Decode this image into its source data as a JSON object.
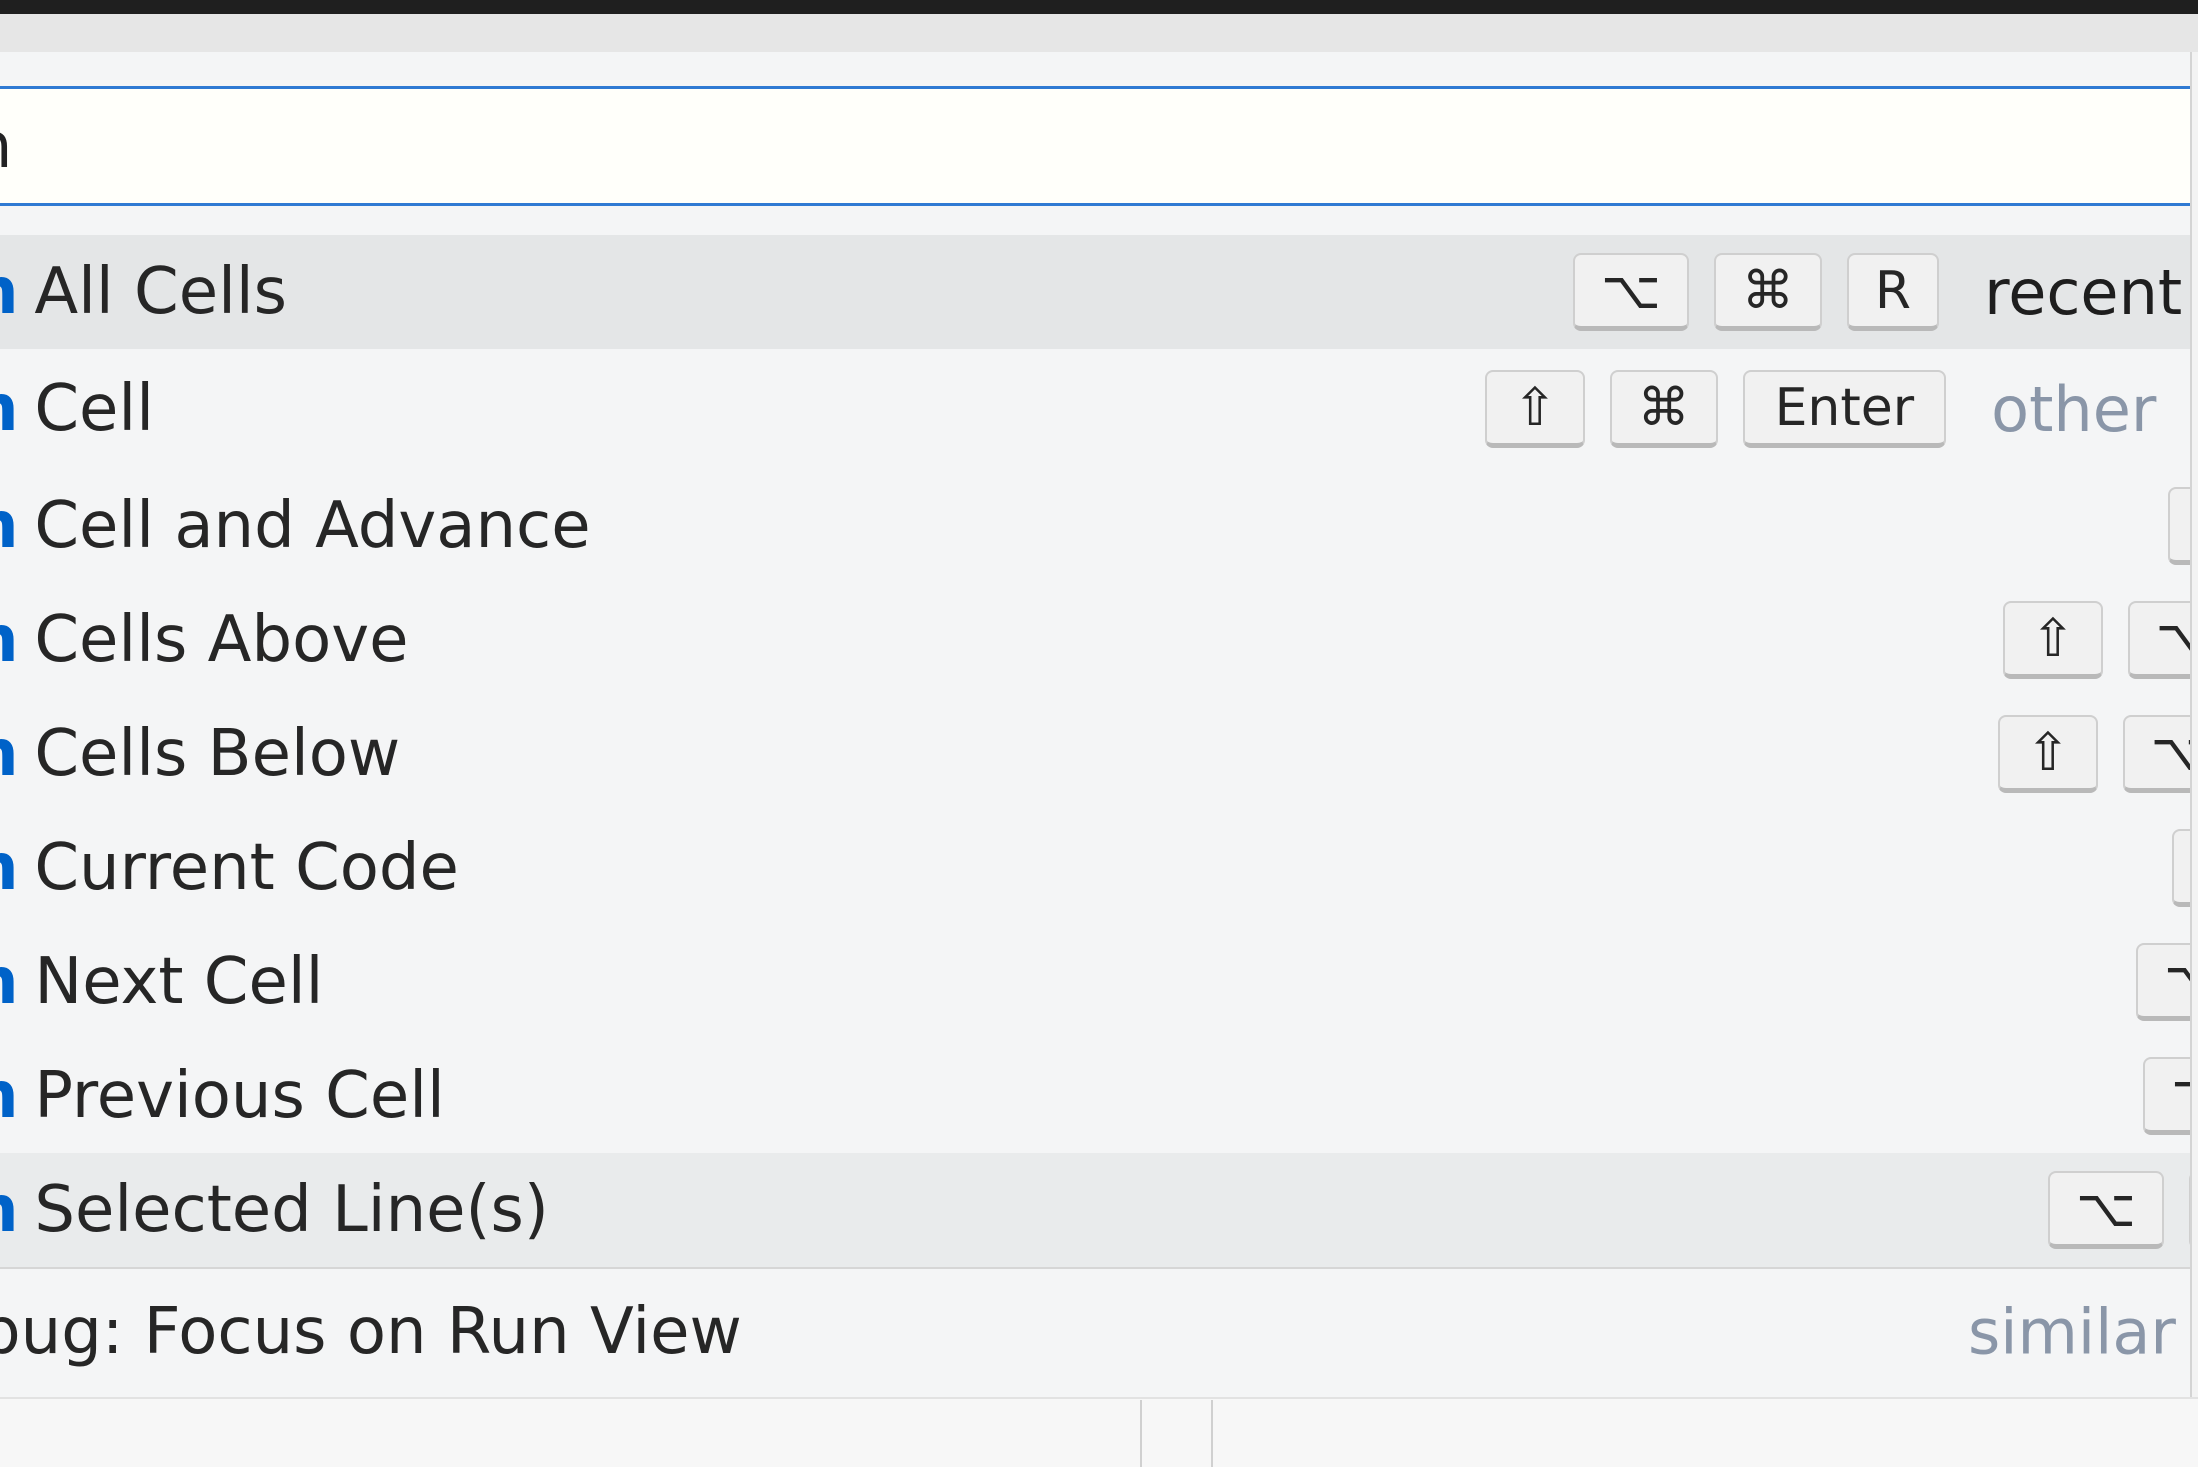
{
  "search": {
    "value": "n",
    "placeholder": ""
  },
  "commands": [
    {
      "prefix": "n",
      "rest": " All Cells",
      "keys": [
        "⌥",
        "⌘",
        "R"
      ],
      "tag": "recent"
    },
    {
      "prefix": "n",
      "rest": " Cell",
      "keys": [
        "⇧",
        "⌘",
        "Enter"
      ],
      "tag": "other"
    },
    {
      "prefix": "n",
      "rest": " Cell and Advance",
      "keys": [],
      "tag": ""
    },
    {
      "prefix": "n",
      "rest": " Cells Above",
      "keys": [
        "⇧",
        "⌥"
      ],
      "tag": ""
    },
    {
      "prefix": "n",
      "rest": " Cells Below",
      "keys": [
        "⇧",
        "⌥"
      ],
      "tag": ""
    },
    {
      "prefix": "n",
      "rest": " Current Code",
      "keys": [],
      "tag": ""
    },
    {
      "prefix": "n",
      "rest": " Next Cell",
      "keys": [
        "⌥"
      ],
      "tag": ""
    },
    {
      "prefix": "n",
      "rest": " Previous Cell",
      "keys": [
        "⌥"
      ],
      "tag": ""
    },
    {
      "prefix": "n",
      "rest": " Selected Line(s)",
      "keys": [
        "⌥"
      ],
      "tag": ""
    },
    {
      "prefix": "",
      "rest": "bug: Focus on Run View",
      "keys": [],
      "tag": "similar"
    }
  ],
  "colors": {
    "match_highlight": "#0062c8",
    "focus_border": "#2f7ad3",
    "tag_muted": "#8a96a8"
  }
}
